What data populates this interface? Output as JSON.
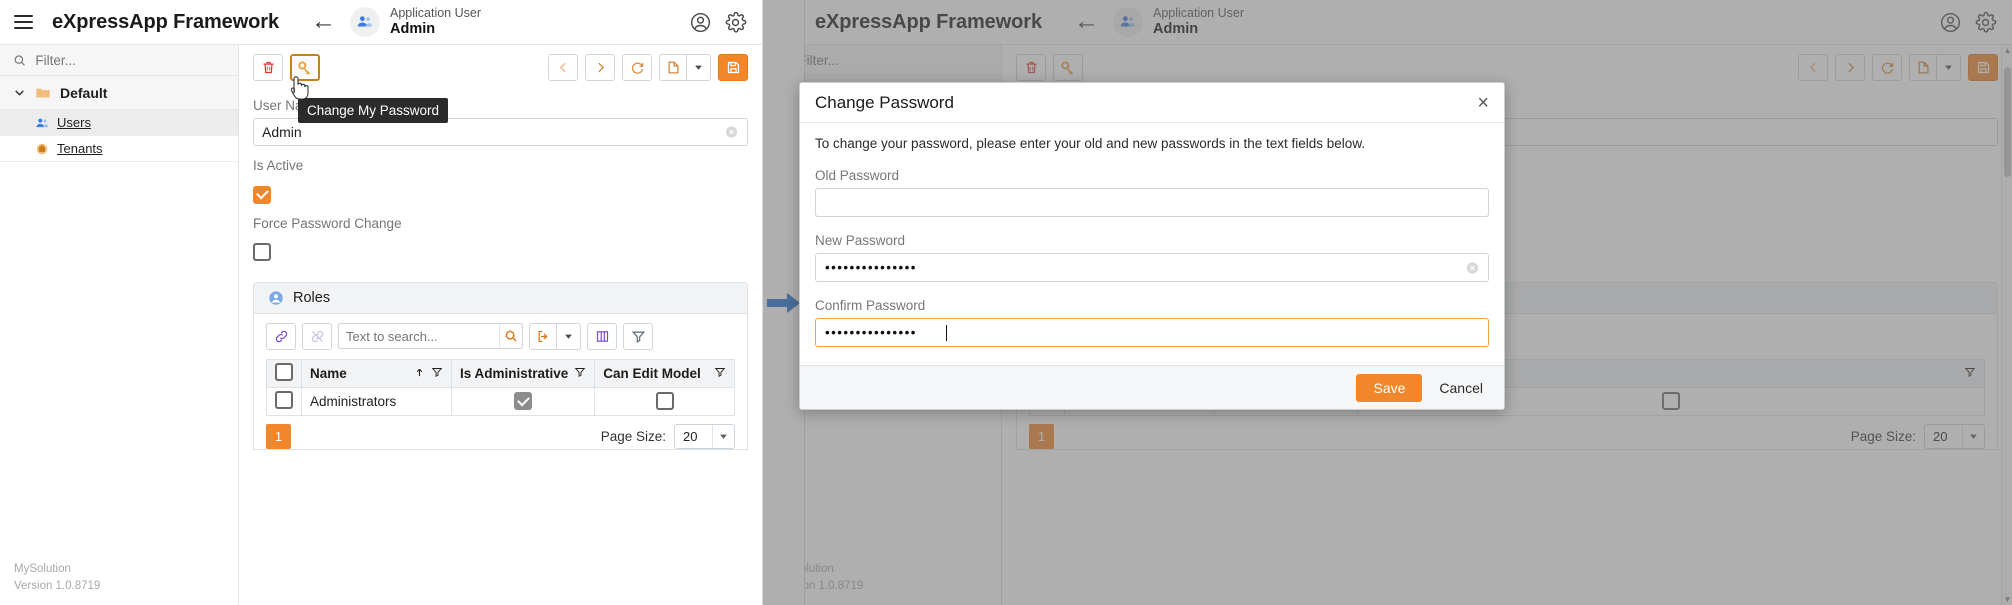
{
  "app": {
    "brand": "eXpressApp Framework",
    "breadcrumb_top": "Application User",
    "breadcrumb_bottom": "Admin",
    "accent_orange": "#f1862a",
    "accent_blue": "#1f6fd0"
  },
  "sidebar": {
    "filter_placeholder": "Filter...",
    "group_label": "Default",
    "items": [
      {
        "label": "Users",
        "selected": true
      },
      {
        "label": "Tenants",
        "selected": false
      }
    ],
    "footer_line1": "MySolution",
    "footer_line2": "Version 1.0.8719"
  },
  "toolbar": {
    "delete_title": "Delete",
    "change_password_title": "Change My Password",
    "prev_title": "Previous Object",
    "next_title": "Next Object",
    "refresh_title": "Refresh",
    "new_title": "New",
    "new_dropdown_title": "New options",
    "save_title": "Save"
  },
  "tooltip": {
    "text": "Change My Password"
  },
  "detail": {
    "username_label": "User Name",
    "username_value": "Admin",
    "is_active_label": "Is Active",
    "is_active_checked": true,
    "force_password_change_label": "Force Password Change",
    "force_password_change_checked": false
  },
  "roles_card": {
    "title": "Roles",
    "search_placeholder": "Text to search...",
    "link_title": "Link",
    "unlink_title": "Unlink",
    "search_title": "Search",
    "export_title": "Export",
    "columns_title": "Choose Columns",
    "filter_title": "Filter Editor",
    "columns": [
      "Name",
      "Is Administrative",
      "Can Edit Model"
    ],
    "sorted_column": "Name",
    "sort_direction": "asc",
    "rows": [
      {
        "selected": false,
        "name": "Administrators",
        "is_administrative": true,
        "can_edit_model": false
      }
    ],
    "page_number": "1",
    "page_size_label": "Page Size:",
    "page_size_value": "20"
  },
  "modal": {
    "title": "Change Password",
    "close_label": "×",
    "description": "To change your password, please enter your old and new passwords in the text fields below.",
    "old_password_label": "Old Password",
    "old_password_value": "",
    "new_password_label": "New Password",
    "new_password_value": "•••••••••••••••",
    "confirm_password_label": "Confirm Password",
    "confirm_password_value": "•••••••••••••••",
    "save_label": "Save",
    "cancel_label": "Cancel"
  }
}
